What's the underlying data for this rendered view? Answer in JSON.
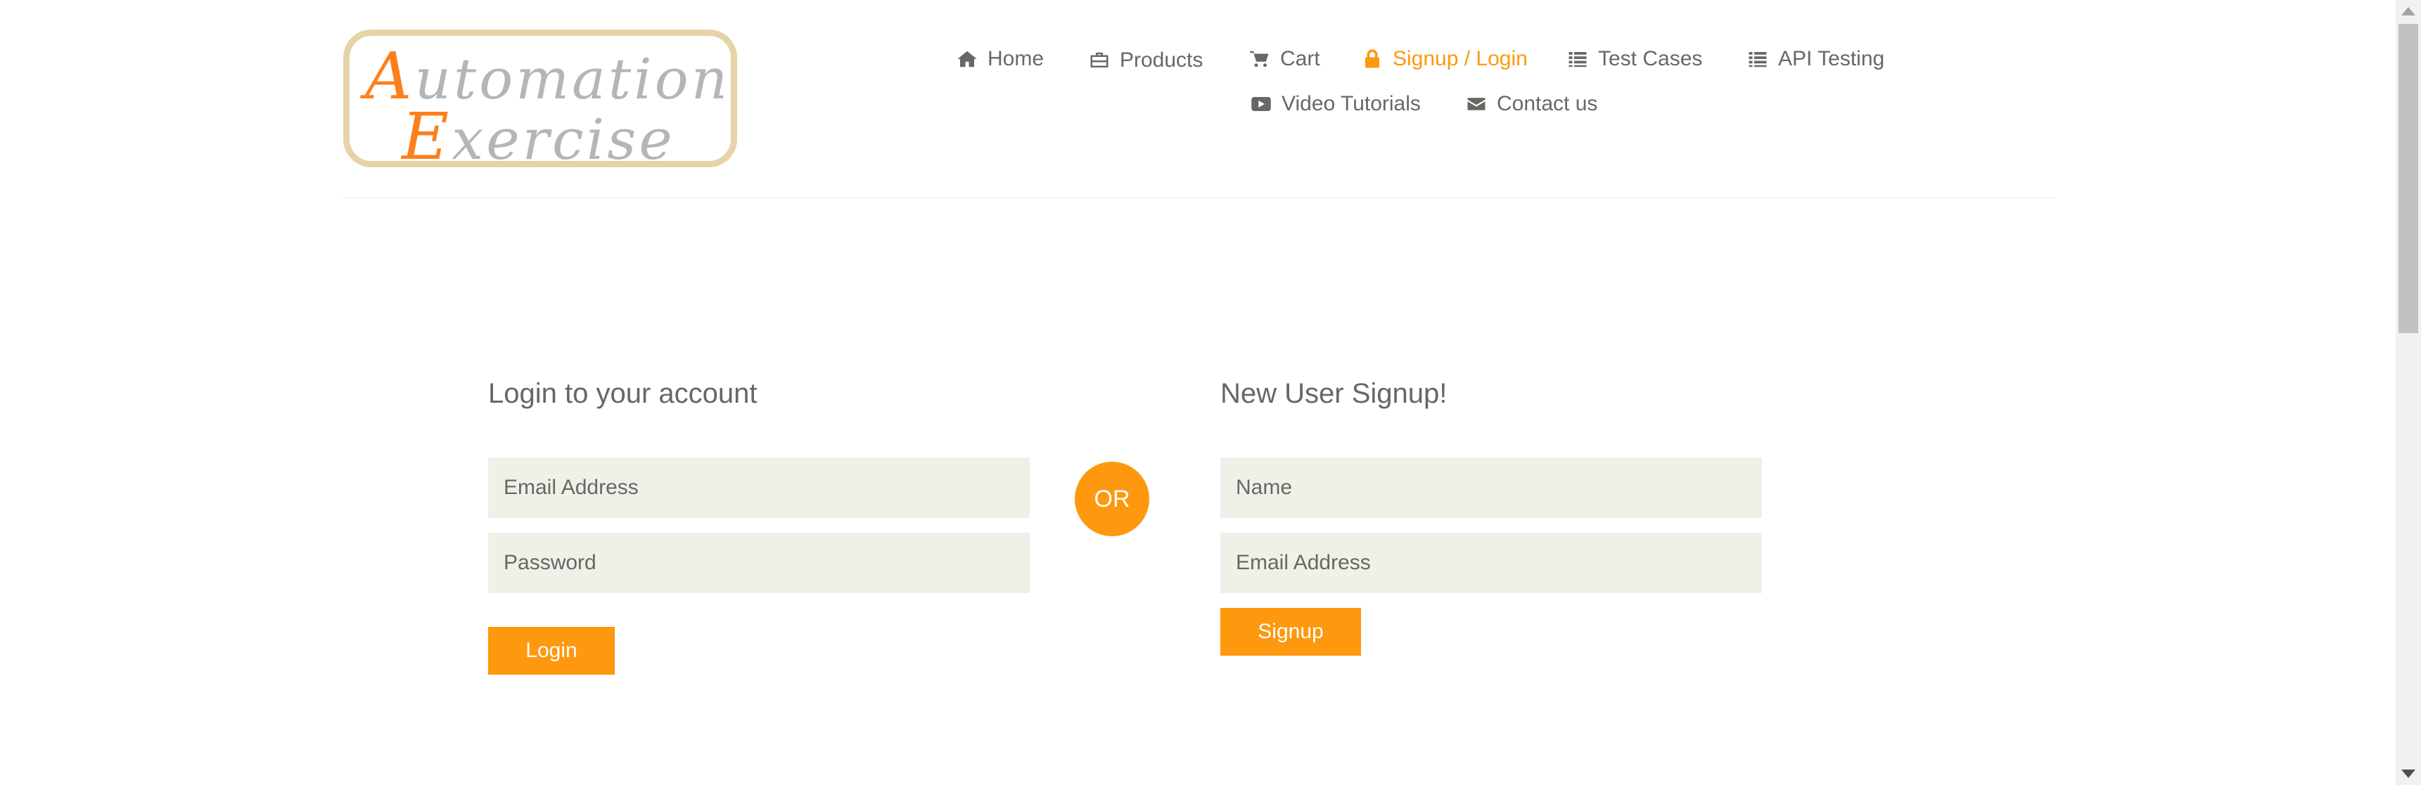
{
  "logo": {
    "line1_cap": "A",
    "line1_rest": "utomation",
    "line2_cap": "E",
    "line2_rest": "xercise"
  },
  "nav": {
    "home": "Home",
    "products": "Products",
    "cart": "Cart",
    "signup_login": "Signup / Login",
    "test_cases": "Test Cases",
    "api_testing": "API Testing",
    "video_tutorials": "Video Tutorials",
    "contact_us": "Contact us",
    "active": "Signup / Login"
  },
  "login": {
    "title": "Login to your account",
    "email_placeholder": "Email Address",
    "email_value": "",
    "password_placeholder": "Password",
    "password_value": "",
    "button": "Login"
  },
  "or_label": "OR",
  "signup": {
    "title": "New User Signup!",
    "name_placeholder": "Name",
    "name_value": "",
    "email_placeholder": "Email Address",
    "email_value": "",
    "button": "Signup"
  },
  "colors": {
    "accent": "#fe980f",
    "input_bg": "#f0f0e9",
    "text": "#696763",
    "logo_border": "#e6d3a7"
  }
}
